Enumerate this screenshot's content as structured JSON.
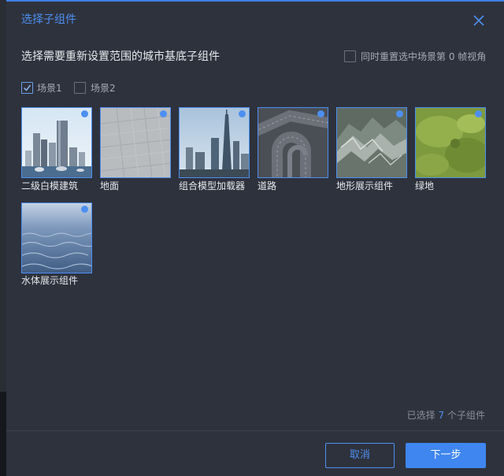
{
  "dialog": {
    "title": "选择子组件",
    "subtitle": "选择需要重新设置范围的城市基底子组件",
    "sync_label": "同时重置选中场景第 0 帧视角",
    "sync_checked": false
  },
  "scenes": [
    {
      "label": "场景1",
      "checked": true
    },
    {
      "label": "场景2",
      "checked": false
    }
  ],
  "components": [
    {
      "label": "二级白模建筑",
      "thumb": "city-skyline"
    },
    {
      "label": "地面",
      "thumb": "concrete-ground"
    },
    {
      "label": "组合模型加载器",
      "thumb": "towers"
    },
    {
      "label": "道路",
      "thumb": "road-loop"
    },
    {
      "label": "地形展示组件",
      "thumb": "mountain-terrain"
    },
    {
      "label": "绿地",
      "thumb": "grass"
    },
    {
      "label": "水体展示组件",
      "thumb": "water"
    }
  ],
  "footer": {
    "count_prefix": "已选择",
    "count": "7",
    "count_suffix": "个子组件",
    "cancel_label": "取消",
    "next_label": "下一步"
  },
  "colors": {
    "accent": "#4d8ff0",
    "dialog_bg": "#2e323d"
  }
}
